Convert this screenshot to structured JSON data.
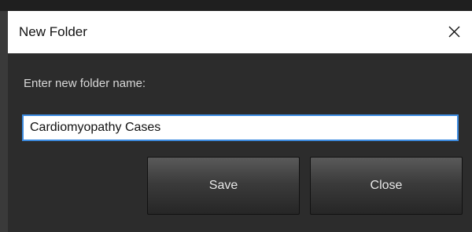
{
  "dialog": {
    "title": "New Folder",
    "prompt": "Enter new folder name:",
    "folder_name_value": "Cardiomyopathy Cases",
    "close_icon": "close-icon",
    "buttons": {
      "save_label": "Save",
      "close_label": "Close"
    }
  },
  "colors": {
    "dialog_background": "#2c2c2c",
    "titlebar_background": "#ffffff",
    "input_focus_border": "#3c8be0",
    "button_text": "#e8e8e8"
  }
}
